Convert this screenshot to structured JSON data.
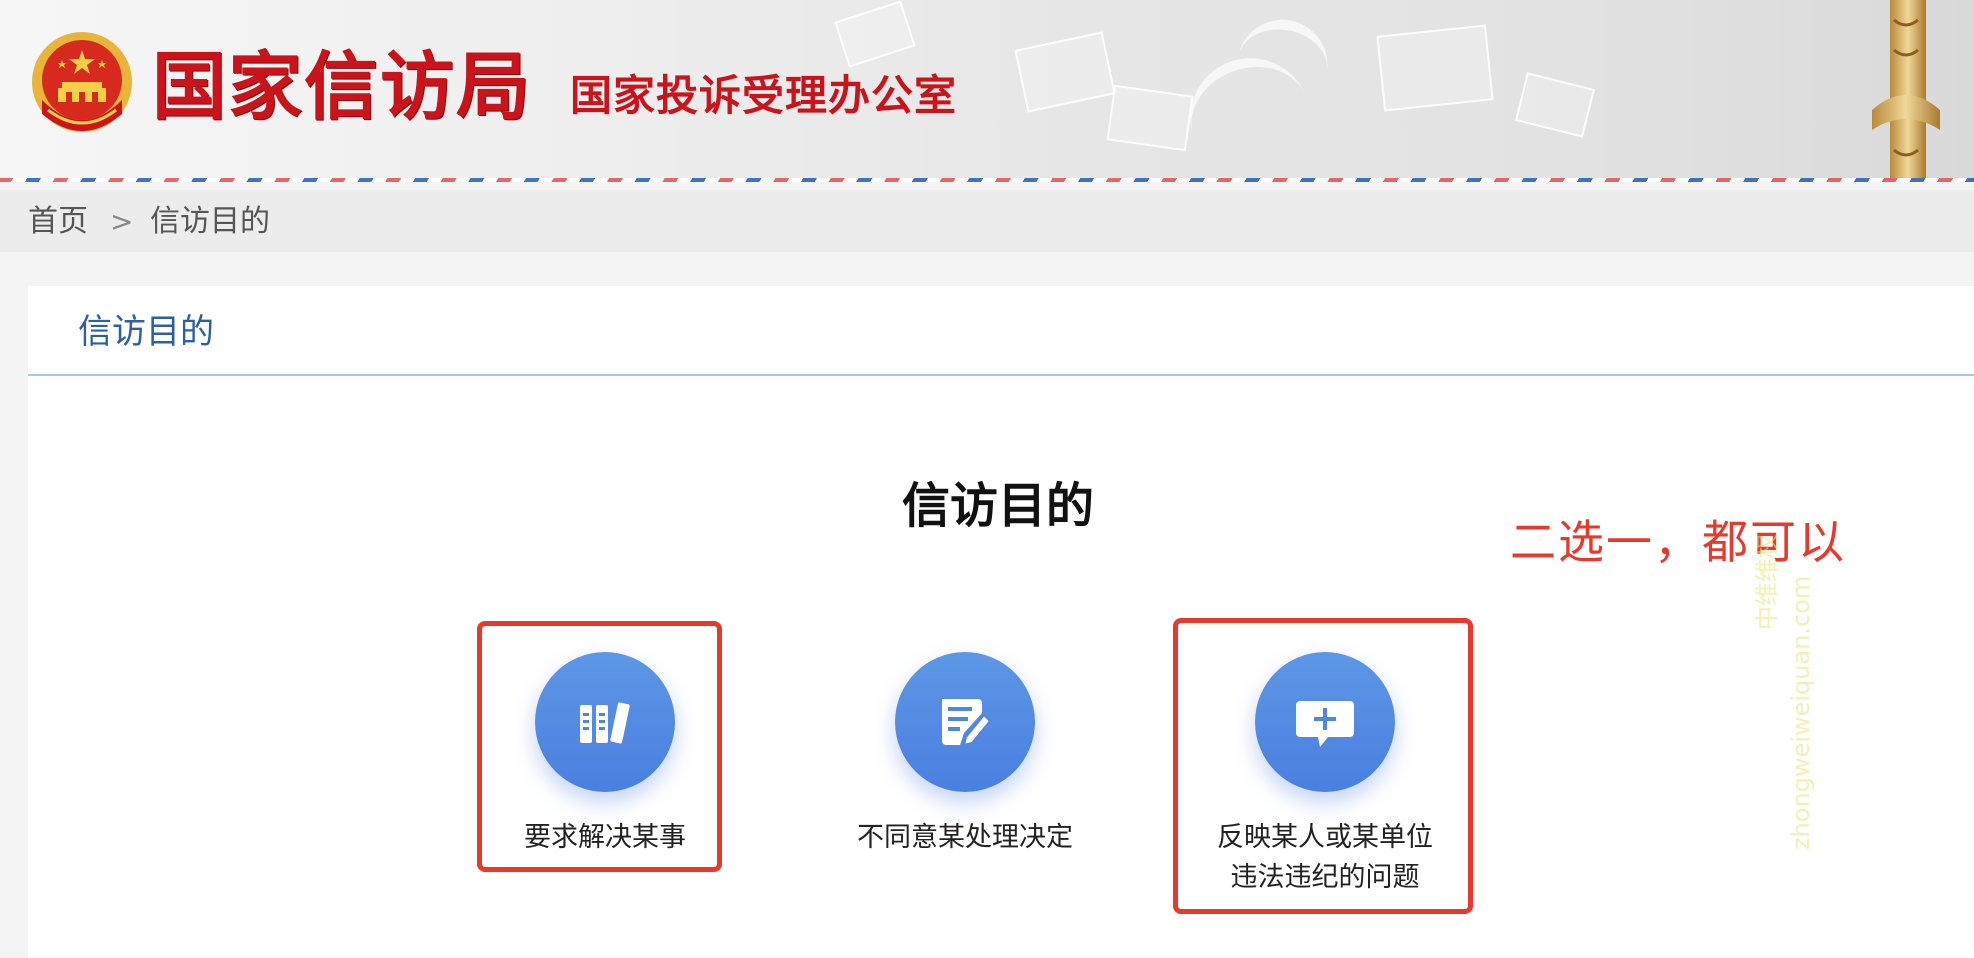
{
  "header": {
    "site_title": "国家信访局",
    "site_subtitle": "国家投诉受理办公室"
  },
  "breadcrumb": {
    "home": "首页",
    "separator": ">",
    "current": "信访目的"
  },
  "card": {
    "header_title": "信访目的",
    "section_title": "信访目的",
    "annotation_note": "二选一，都可以",
    "options": [
      {
        "label": "要求解决某事",
        "icon": "books-icon",
        "highlighted": true
      },
      {
        "label": "不同意某处理决定",
        "icon": "edit-document-icon",
        "highlighted": false
      },
      {
        "label_line1": "反映某人或某单位",
        "label_line2": "违法违纪的问题",
        "icon": "message-plus-icon",
        "highlighted": true
      }
    ]
  },
  "watermark": {
    "line1": "中维维权",
    "line2": "zhongweiweiquan.com"
  },
  "colors": {
    "brand_red": "#c8141a",
    "link_blue": "#2d5fa3",
    "icon_blue": "#4f86e2",
    "annotation_red": "#e63a2c"
  }
}
